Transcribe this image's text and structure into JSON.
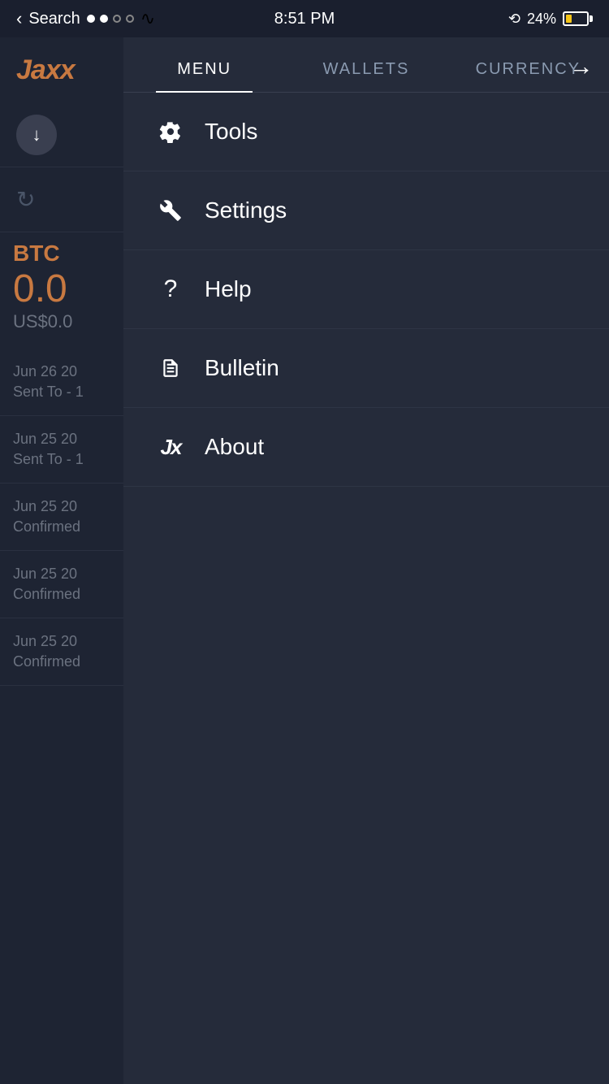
{
  "statusBar": {
    "back": "Search",
    "time": "8:51 PM",
    "batteryPercent": "24%"
  },
  "leftPanel": {
    "logo": "Jaxx",
    "currency": "BTC",
    "amount": "0.0",
    "usd": "US$0.0",
    "transactions": [
      {
        "date": "Jun 26 20",
        "status": "Sent To - 1"
      },
      {
        "date": "Jun 25 20",
        "status": "Sent To - 1"
      },
      {
        "date": "Jun 25 20",
        "status": "Confirmed"
      },
      {
        "date": "Jun 25 20",
        "status": "Confirmed"
      },
      {
        "date": "Jun 25 20",
        "status": "Confirmed"
      }
    ]
  },
  "menu": {
    "tabs": [
      {
        "label": "MENU",
        "active": true
      },
      {
        "label": "WALLETS",
        "active": false
      },
      {
        "label": "CURRENCY",
        "active": false
      }
    ],
    "items": [
      {
        "id": "tools",
        "label": "Tools",
        "icon": "gear"
      },
      {
        "id": "settings",
        "label": "Settings",
        "icon": "wrench"
      },
      {
        "id": "help",
        "label": "Help",
        "icon": "question"
      },
      {
        "id": "bulletin",
        "label": "Bulletin",
        "icon": "document"
      },
      {
        "id": "about",
        "label": "About",
        "icon": "jaxx-x"
      }
    ]
  }
}
